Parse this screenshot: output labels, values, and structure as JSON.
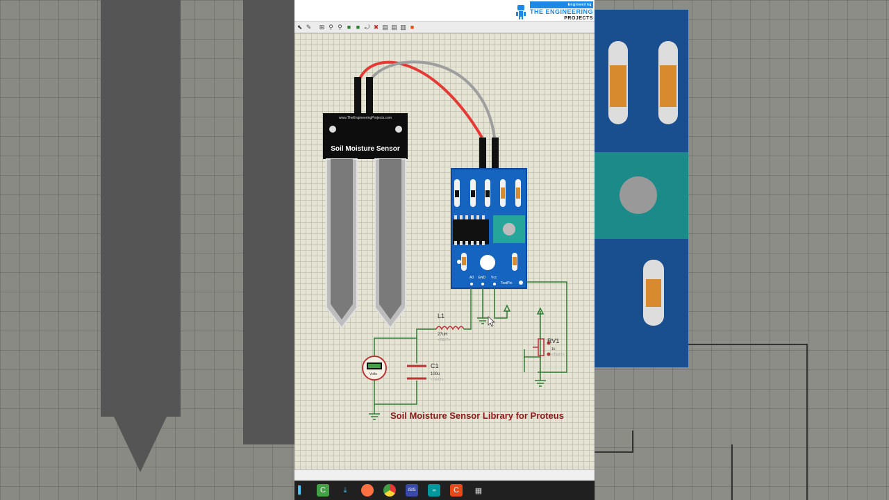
{
  "header": {
    "brand_top": "THE ENGINEERING",
    "brand_bottom": "PROJECTS",
    "brand_badge": "Engineering"
  },
  "sensor_probe": {
    "url": "www.TheEngineeringProjects.com",
    "label": "Soil Moisture Sensor"
  },
  "module": {
    "pin_labels": [
      "A0",
      "GND",
      "Vcc",
      "TestPin"
    ]
  },
  "components": {
    "L1": {
      "name": "L1",
      "value": "27uH",
      "text": "<TEXT>"
    },
    "C1": {
      "name": "C1",
      "value": "100u",
      "text": "<TEXT>"
    },
    "RV1": {
      "name": "RV1",
      "value": "1k",
      "text": "<TEXT>"
    },
    "voltmeter": {
      "label": "Volts"
    }
  },
  "caption": "Soil Moisture Sensor Library for Proteus",
  "colors": {
    "wire_green": "#2e7d32",
    "wire_red": "#e53935",
    "module_blue": "#1565c0",
    "caption": "#8b1a1a"
  },
  "toolbar_icons": [
    "pointer-icon",
    "probe-icon",
    "component-icon",
    "zoom-icon",
    "zoom-all-icon",
    "copy-icon",
    "move-icon",
    "rotate-icon",
    "delete-icon",
    "pick-icon",
    "library-icon",
    "decompose-icon",
    "stop-icon"
  ],
  "taskbar_icons": [
    "start-icon",
    "camtasia-icon",
    "download-icon",
    "firefox-icon",
    "chrome-icon",
    "proteus-icon",
    "arduino-icon",
    "camtasia-red-icon",
    "folder-icon"
  ]
}
